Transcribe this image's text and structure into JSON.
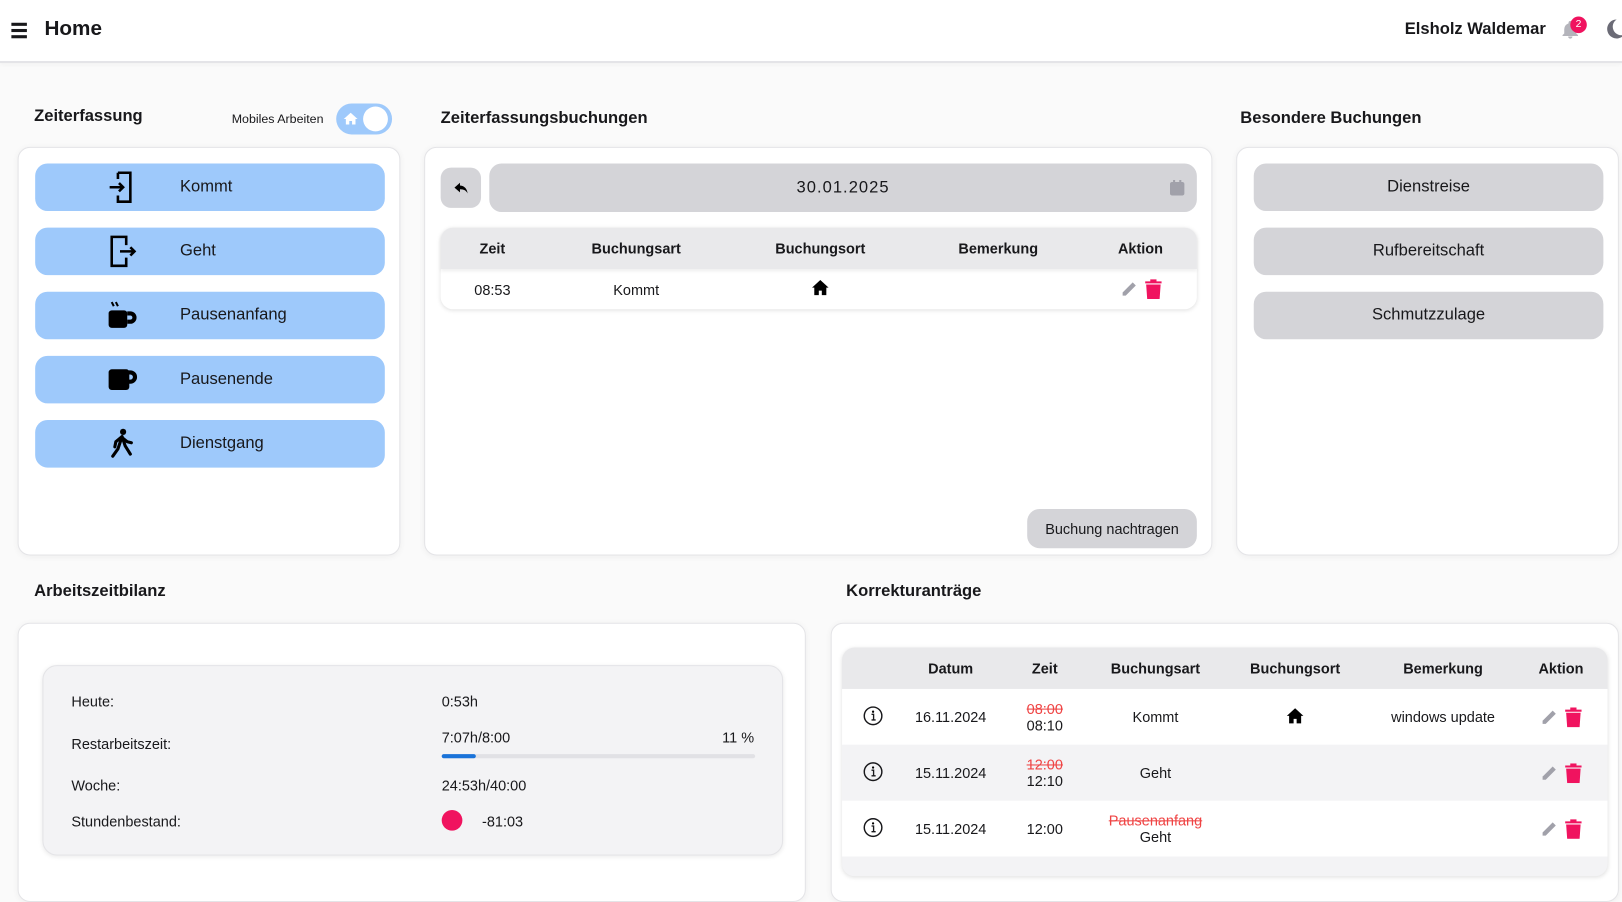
{
  "header": {
    "title": "Home",
    "user": "Elsholz Waldemar",
    "notification_count": "2"
  },
  "zeiterfassung": {
    "title": "Zeiterfassung",
    "toggle_label": "Mobiles Arbeiten",
    "toggle_on": true,
    "buttons": [
      {
        "label": "Kommt",
        "icon": "login-icon"
      },
      {
        "label": "Geht",
        "icon": "logout-icon"
      },
      {
        "label": "Pausenanfang",
        "icon": "hot-coffee-icon"
      },
      {
        "label": "Pausenende",
        "icon": "coffee-icon"
      },
      {
        "label": "Dienstgang",
        "icon": "walking-icon"
      }
    ]
  },
  "buchungen": {
    "title": "Zeiterfassungsbuchungen",
    "date": "30.01.2025",
    "columns": [
      "Zeit",
      "Buchungsart",
      "Buchungsort",
      "Bemerkung",
      "Aktion"
    ],
    "rows": [
      {
        "zeit": "08:53",
        "art": "Kommt",
        "ort": "home-icon",
        "bemerkung": ""
      }
    ],
    "add_button": "Buchung nachtragen"
  },
  "besondere": {
    "title": "Besondere Buchungen",
    "buttons": [
      "Dienstreise",
      "Rufbereitschaft",
      "Schmutzzulage"
    ]
  },
  "bilanz": {
    "title": "Arbeitszeitbilanz",
    "heute_label": "Heute:",
    "heute": "0:53h",
    "rest_label": "Restarbeitszeit:",
    "rest": "7:07h/8:00",
    "rest_percent_text": "11 %",
    "rest_progress": 11,
    "woche_label": "Woche:",
    "woche": "24:53h/40:00",
    "bestand_label": "Stundenbestand:",
    "bestand": "-81:03",
    "bestand_color": "#f0135f"
  },
  "korrektur": {
    "title": "Korrekturanträge",
    "columns": [
      "",
      "Datum",
      "Zeit",
      "Buchungsart",
      "Buchungsort",
      "Bemerkung",
      "Aktion"
    ],
    "rows": [
      {
        "datum": "16.11.2024",
        "zeit_old": "08:00",
        "zeit": "08:10",
        "art_old": "",
        "art": "Kommt",
        "ort": "home-icon",
        "bemerkung": "windows update"
      },
      {
        "datum": "15.11.2024",
        "zeit_old": "12:00",
        "zeit": "12:10",
        "art_old": "",
        "art": "Geht",
        "ort": "",
        "bemerkung": ""
      },
      {
        "datum": "15.11.2024",
        "zeit_old": "",
        "zeit": "12:00",
        "art_old": "Pausenanfang",
        "art": "Geht",
        "ort": "",
        "bemerkung": ""
      }
    ]
  },
  "colors": {
    "accent": "#9ec9fb",
    "danger": "#f0135f",
    "progress": "#1a73d9"
  }
}
